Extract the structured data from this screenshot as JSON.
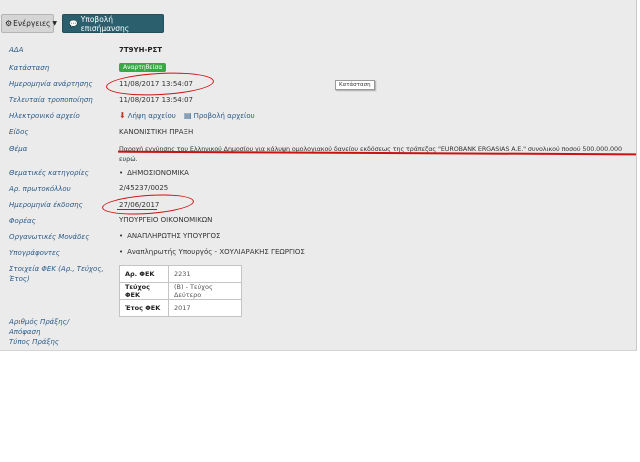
{
  "toolbar": {
    "actions_label": "Ενέργειες",
    "report_label": "Υποβολή επισήμανσης"
  },
  "fields": {
    "ada": {
      "label": "ΑΔΑ",
      "value": "7Τ9ΥΗ-ΡΣΤ"
    },
    "status": {
      "label": "Κατάσταση",
      "value": "Αναρτηθείσα"
    },
    "published": {
      "label": "Ημερομηνία ανάρτησης",
      "value": "11/08/2017 13:54:07"
    },
    "modified": {
      "label": "Τελευταία τροποποίηση",
      "value": "11/08/2017 13:54:07"
    },
    "file": {
      "label": "Ηλεκτρονικό αρχείο",
      "download": "Λήψη αρχείου",
      "preview": "Προβολή αρχείου"
    },
    "type": {
      "label": "Είδος",
      "value": "ΚΑΝΟΝΙΣΤΙΚΗ ΠΡΑΞΗ"
    },
    "subject": {
      "label": "Θέμα",
      "line1": "Παροχή εγγύησης του Ελληνικού Δημοσίου για κάλυψη ομολογιακού δανείου εκδόσεως της τράπεζας \"EUROBANK ERGASIAS A.E.\" συνολικού ποσού 500.000.000",
      "line2": "ευρώ."
    },
    "categories": {
      "label": "Θεματικές κατηγορίες",
      "value": "ΔΗΜΟΣΙΟΝΟΜΙΚΑ"
    },
    "protocol": {
      "label": "Αρ. πρωτοκόλλου",
      "value": "2/45237/0025"
    },
    "issue_date": {
      "label": "Ημερομηνία έκδοσης",
      "value": "27/06/2017"
    },
    "org": {
      "label": "Φορέας",
      "value": "ΥΠΟΥΡΓΕΙΟ ΟΙΚΟΝΟΜΙΚΩΝ"
    },
    "units": {
      "label": "Οργανωτικές Μονάδες",
      "value": "ΑΝΑΠΛΗΡΩΤΗΣ ΥΠΟΥΡΓΟΣ"
    },
    "signers": {
      "label": "Υπογράφοντες",
      "value": "Αναπληρωτής Υπουργός - ΧΟΥΛΙΑΡΑΚΗΣ ΓΕΩΡΓΙΟΣ"
    },
    "fek": {
      "label_line1": "Στοιχεία ΦΕΚ (Αρ., Τεύχος,",
      "label_line2": "Έτος)",
      "rows": [
        {
          "k": "Αρ. ΦΕΚ",
          "v": "2231"
        },
        {
          "k": "Τεύχος ΦΕΚ",
          "v": "(Β) - Τεύχος Δεύτερο"
        },
        {
          "k": "Έτος ΦΕΚ",
          "v": "2017"
        }
      ]
    },
    "act_number": {
      "label_line1": "Αριθμός Πράξης/",
      "label_line2": "Απόφαση",
      "label_line3": "Τύπος Πράξης"
    }
  },
  "tooltip": "Κατάσταση"
}
